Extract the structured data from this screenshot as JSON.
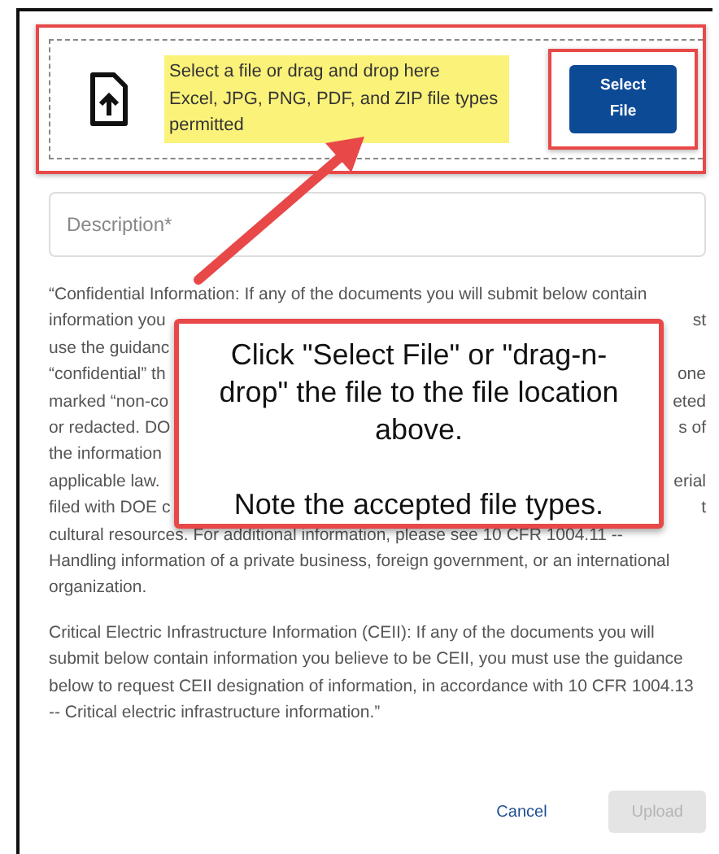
{
  "upload": {
    "prompt": "Select a file or drag and drop here",
    "file_types": "Excel, JPG, PNG, PDF, and ZIP file types permitted",
    "select_button": "Select File"
  },
  "description": {
    "placeholder": "Description*"
  },
  "notice": {
    "lines": [
      {
        "left": "“Confidential Information: If any of the documents you will submit below contain"
      },
      {
        "left": "information you",
        "right": "st"
      },
      {
        "left": "use the guidanc"
      },
      {
        "left": "“confidential” th",
        "right": "one"
      },
      {
        "left": "marked “non-co",
        "right": "eted"
      },
      {
        "left": "or redacted. DO",
        "right": "s of"
      },
      {
        "left": "the information"
      },
      {
        "left": "applicable law.",
        "right": "erial"
      },
      {
        "left": "filed with DOE c",
        "right": "t"
      },
      {
        "left": "cultural resources. For additional information, please see 10 CFR 1004.11 --"
      },
      {
        "left": "Handling information of a private business, foreign government, or an international"
      },
      {
        "left": "organization."
      }
    ],
    "paragraph_2": "Critical Electric Infrastructure Information (CEII): If any of the documents you will submit below contain information you believe to be CEII, you must use the guidance below to request CEII designation of information, in accordance with 10 CFR 1004.13 -- Critical electric infrastructure information.”"
  },
  "callout": {
    "lines": [
      "Click \"Select File\" or \"drag-n-drop\" the file to the file location above.",
      "Note the accepted file types."
    ]
  },
  "buttons": [
    {
      "label": "Cancel",
      "kind": "text",
      "disabled": false
    },
    {
      "label": "Upload",
      "kind": "filled",
      "disabled": true
    }
  ]
}
